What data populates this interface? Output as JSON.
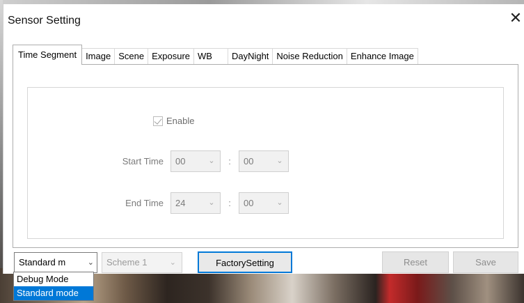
{
  "window": {
    "title": "Sensor Setting",
    "close_glyph": "✕"
  },
  "tabs": [
    {
      "label": "Time Segment",
      "active": true
    },
    {
      "label": "Image",
      "active": false
    },
    {
      "label": "Scene",
      "active": false
    },
    {
      "label": "Exposure",
      "active": false
    },
    {
      "label": "WB",
      "active": false
    },
    {
      "label": "DayNight",
      "active": false
    },
    {
      "label": "Noise Reduction",
      "active": false
    },
    {
      "label": "Enhance Image",
      "active": false
    }
  ],
  "time_segment": {
    "enable_label": "Enable",
    "enable_checked": true,
    "start_time": {
      "label": "Start Time",
      "hour": "00",
      "minute": "00",
      "separator": ":"
    },
    "end_time": {
      "label": "End Time",
      "hour": "24",
      "minute": "00",
      "separator": ":"
    }
  },
  "bottom": {
    "mode_select_value": "Standard m",
    "scheme_select_value": "Scheme 1",
    "factory_button": "FactorySetting",
    "reset_button": "Reset",
    "save_button": "Save"
  },
  "mode_dropdown": {
    "options": [
      {
        "label": "Debug Mode",
        "selected": false
      },
      {
        "label": "Standard mode",
        "selected": true
      }
    ]
  },
  "icons": {
    "chevron": "chevron-down-icon",
    "check": "check-icon",
    "close": "close-icon"
  },
  "colors": {
    "accent": "#0078d7",
    "disabled_text": "#8d8d8d"
  }
}
